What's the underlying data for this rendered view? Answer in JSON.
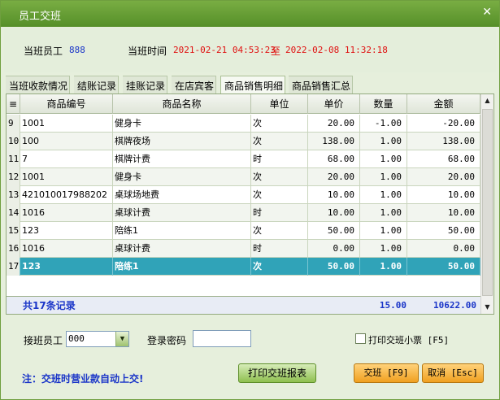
{
  "window": {
    "title": "员工交班",
    "close_icon": "✕"
  },
  "info": {
    "staff_label": "当班员工",
    "staff_value": "888",
    "time_label": "当班时间",
    "time_start": "2021-02-21 04:53:23",
    "time_sep": "至",
    "time_end": "2022-02-08 11:32:18"
  },
  "tabs": [
    {
      "label": "当班收款情况"
    },
    {
      "label": "结账记录"
    },
    {
      "label": "挂账记录"
    },
    {
      "label": "在店宾客"
    },
    {
      "label": "商品销售明细"
    },
    {
      "label": "商品销售汇总"
    }
  ],
  "grid": {
    "columns": [
      "",
      "商品编号",
      "商品名称",
      "单位",
      "单价",
      "数量",
      "金额"
    ],
    "rows": [
      {
        "idx": "9",
        "code": "1001",
        "name": "健身卡",
        "unit": "次",
        "price": "20.00",
        "qty": "-1.00",
        "amount": "-20.00"
      },
      {
        "idx": "10",
        "code": "100",
        "name": "棋牌夜场",
        "unit": "次",
        "price": "138.00",
        "qty": "1.00",
        "amount": "138.00"
      },
      {
        "idx": "11",
        "code": "7",
        "name": "棋牌计费",
        "unit": "时",
        "price": "68.00",
        "qty": "1.00",
        "amount": "68.00"
      },
      {
        "idx": "12",
        "code": "1001",
        "name": "健身卡",
        "unit": "次",
        "price": "20.00",
        "qty": "1.00",
        "amount": "20.00"
      },
      {
        "idx": "13",
        "code": "421010017988202",
        "name": "桌球场地费",
        "unit": "次",
        "price": "10.00",
        "qty": "1.00",
        "amount": "10.00"
      },
      {
        "idx": "14",
        "code": "1016",
        "name": "桌球计费",
        "unit": "时",
        "price": "10.00",
        "qty": "1.00",
        "amount": "10.00"
      },
      {
        "idx": "15",
        "code": "123",
        "name": "陪练1",
        "unit": "次",
        "price": "50.00",
        "qty": "1.00",
        "amount": "50.00"
      },
      {
        "idx": "16",
        "code": "1016",
        "name": "桌球计费",
        "unit": "时",
        "price": "0.00",
        "qty": "1.00",
        "amount": "0.00"
      },
      {
        "idx": "17",
        "code": "123",
        "name": "陪练1",
        "unit": "次",
        "price": "50.00",
        "qty": "1.00",
        "amount": "50.00"
      }
    ],
    "footer": {
      "count": "共17条记录",
      "qty_total": "15.00",
      "amount_total": "10622.00"
    }
  },
  "bottom": {
    "next_staff_label": "接班员工",
    "next_staff_value": "000",
    "password_label": "登录密码",
    "print_ticket_label": "打印交班小票 [F5]",
    "note": "注：交班时营业款自动上交!",
    "print_report_button": "打印交班报表",
    "handover_button": "交班 [F9]",
    "cancel_button": "取消 [Esc]"
  },
  "colors": {
    "accent": "#5d972d",
    "selected_row": "#30a3b8",
    "note_blue": "#1a35c8",
    "time_red": "#e01010"
  }
}
